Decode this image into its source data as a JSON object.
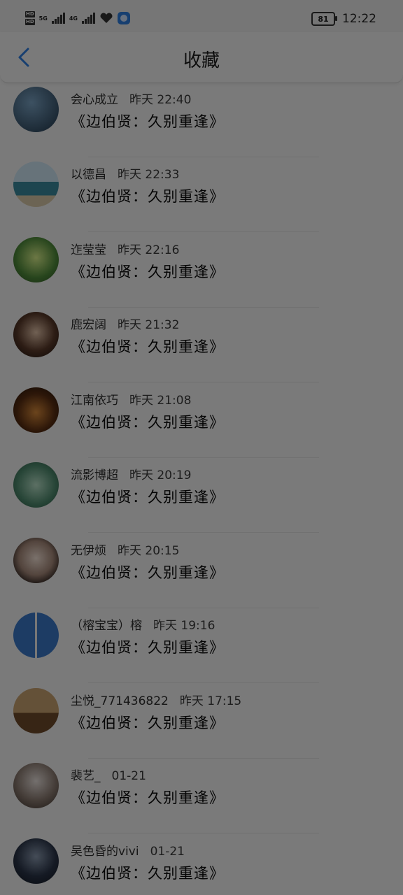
{
  "status_bar": {
    "hd1": "HD",
    "hd2": "HD",
    "net1": "5G",
    "net2": "4G",
    "battery": "81",
    "time": "12:22"
  },
  "header": {
    "title": "收藏",
    "back_icon": "chevron-left-icon",
    "accent_color": "#2f7fe0"
  },
  "items": [
    {
      "name": "会心成立",
      "time": "昨天 22:40",
      "content": "《边伯贤：久别重逢》"
    },
    {
      "name": "以德昌",
      "time": "昨天 22:33",
      "content": "《边伯贤：久别重逢》"
    },
    {
      "name": "迮莹莹",
      "time": "昨天 22:16",
      "content": "《边伯贤：久别重逢》"
    },
    {
      "name": "鹿宏阔",
      "time": "昨天 21:32",
      "content": "《边伯贤：久别重逢》"
    },
    {
      "name": "江南依巧",
      "time": "昨天 21:08",
      "content": "《边伯贤：久别重逢》"
    },
    {
      "name": "流影博超",
      "time": "昨天 20:19",
      "content": "《边伯贤：久别重逢》"
    },
    {
      "name": "无伊烦",
      "time": "昨天 20:15",
      "content": "《边伯贤：久别重逢》"
    },
    {
      "name": "（榕宝宝）榕",
      "time": "昨天 19:16",
      "content": "《边伯贤：久别重逢》"
    },
    {
      "name": "尘悦_771436822",
      "time": "昨天 17:15",
      "content": "《边伯贤：久别重逢》"
    },
    {
      "name": "裴艺_",
      "time": "01-21",
      "content": "《边伯贤：久别重逢》"
    },
    {
      "name": "吴色昏的vivi",
      "time": "01-21",
      "content": "《边伯贤：久别重逢》"
    }
  ]
}
